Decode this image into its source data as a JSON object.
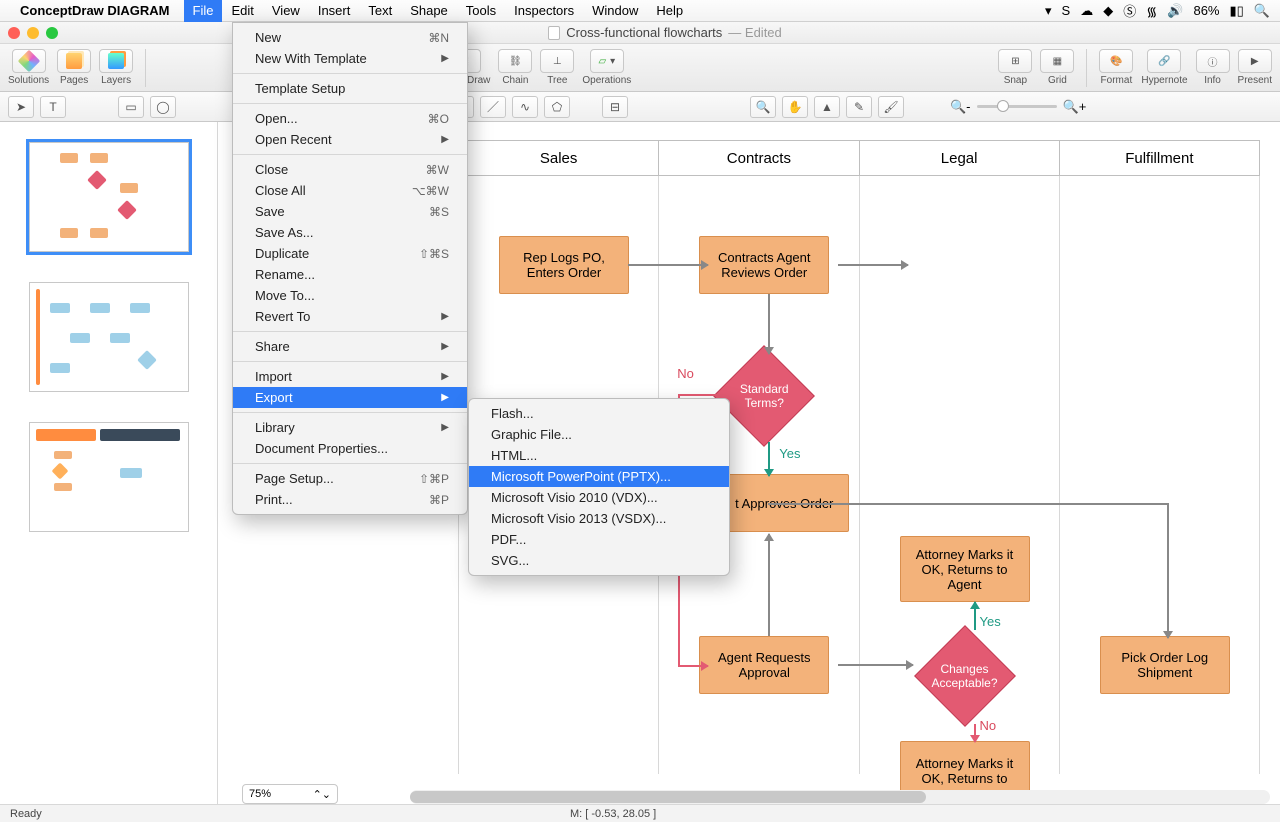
{
  "menubar": {
    "app": "ConceptDraw DIAGRAM",
    "items": [
      "File",
      "Edit",
      "View",
      "Insert",
      "Text",
      "Shape",
      "Tools",
      "Inspectors",
      "Window",
      "Help"
    ],
    "active": "File",
    "right": {
      "battery": "86%"
    }
  },
  "titlebar": {
    "doc": "Cross-functional flowcharts",
    "state": "Edited"
  },
  "toolbar": {
    "solutions": "Solutions",
    "pages": "Pages",
    "layers": "Layers",
    "rapid": "Rapid Draw",
    "chain": "Chain",
    "tree": "Tree",
    "operations": "Operations",
    "snap": "Snap",
    "grid": "Grid",
    "format": "Format",
    "hypernote": "Hypernote",
    "info": "Info",
    "present": "Present"
  },
  "file_menu": [
    {
      "label": "New",
      "sc": "⌘N"
    },
    {
      "label": "New With Template",
      "arr": true
    },
    {
      "sep": true
    },
    {
      "label": "Template Setup"
    },
    {
      "sep": true
    },
    {
      "label": "Open...",
      "sc": "⌘O"
    },
    {
      "label": "Open Recent",
      "arr": true
    },
    {
      "sep": true
    },
    {
      "label": "Close",
      "sc": "⌘W"
    },
    {
      "label": "Close All",
      "sc": "⌥⌘W"
    },
    {
      "label": "Save",
      "sc": "⌘S"
    },
    {
      "label": "Save As..."
    },
    {
      "label": "Duplicate",
      "sc": "⇧⌘S"
    },
    {
      "label": "Rename..."
    },
    {
      "label": "Move To..."
    },
    {
      "label": "Revert To",
      "arr": true
    },
    {
      "sep": true
    },
    {
      "label": "Share",
      "arr": true
    },
    {
      "sep": true
    },
    {
      "label": "Import",
      "arr": true
    },
    {
      "label": "Export",
      "arr": true,
      "sel": true
    },
    {
      "sep": true
    },
    {
      "label": "Library",
      "arr": true
    },
    {
      "label": "Document Properties..."
    },
    {
      "sep": true
    },
    {
      "label": "Page Setup...",
      "sc": "⇧⌘P"
    },
    {
      "label": "Print...",
      "sc": "⌘P"
    }
  ],
  "export_menu": [
    {
      "label": "Flash..."
    },
    {
      "label": "Graphic File..."
    },
    {
      "label": "HTML..."
    },
    {
      "label": "Microsoft PowerPoint (PPTX)...",
      "sel": true
    },
    {
      "label": "Microsoft Visio 2010 (VDX)..."
    },
    {
      "label": "Microsoft Visio 2013 (VSDX)..."
    },
    {
      "label": "PDF..."
    },
    {
      "label": "SVG..."
    }
  ],
  "lanes": [
    "Sales",
    "Contracts",
    "Legal",
    "Fulfillment"
  ],
  "nodes": {
    "rep": "Rep Logs PO, Enters Order",
    "review": "Contracts Agent Reviews Order",
    "terms": "Standard Terms?",
    "approve": "t Approves Order",
    "attok": "Attorney Marks it OK, Returns to Agent",
    "reqapp": "Agent Requests Approval",
    "changes": "Changes Acceptable?",
    "attok2": "Attorney Marks it OK, Returns to",
    "pick": "Pick Order Log Shipment",
    "yes": "Yes",
    "no": "No"
  },
  "zoom": "75%",
  "status": {
    "ready": "Ready",
    "coord": "M: [ -0.53, 28.05 ]"
  }
}
